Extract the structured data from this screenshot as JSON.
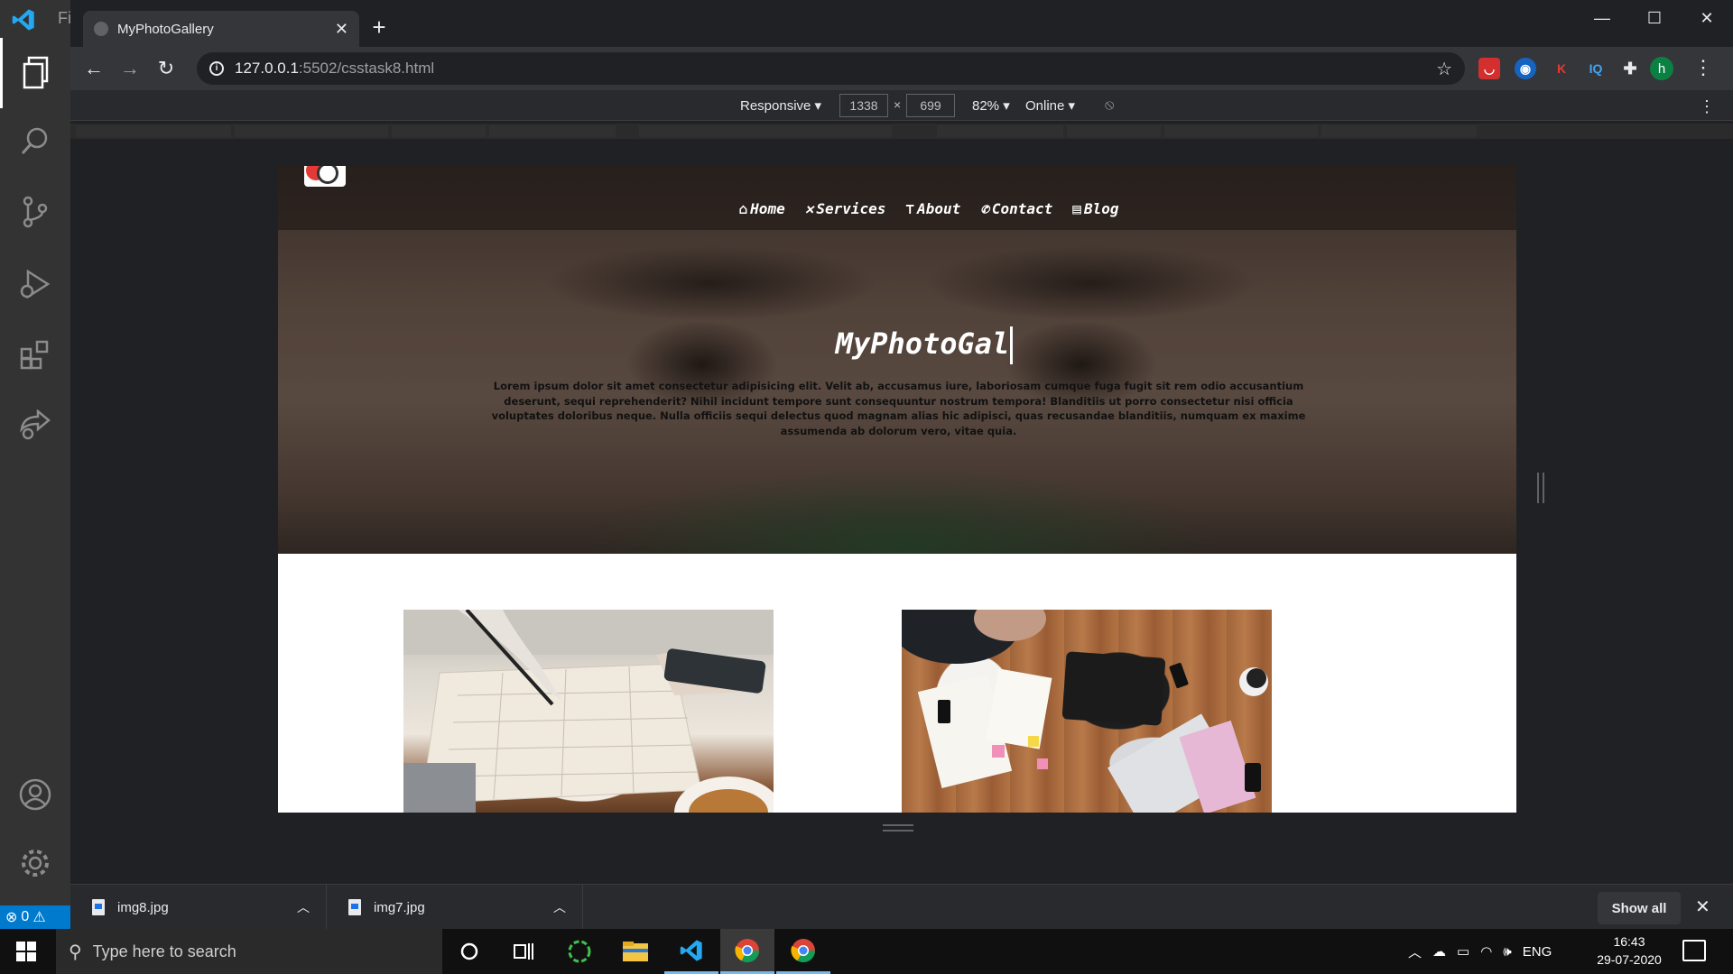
{
  "vscode": {
    "menu_fragment": "Fi",
    "activity_items": [
      "explorer-icon",
      "search-icon",
      "source-control-icon",
      "run-debug-icon",
      "extensions-icon",
      "live-share-icon",
      "account-icon",
      "settings-gear-icon"
    ],
    "status_errors": "0"
  },
  "browser": {
    "tab_title": "MyPhotoGallery",
    "url_host": "127.0.0.1",
    "url_rest": ":5502/csstask8.html",
    "profile_initial": "h",
    "ext_k": "K",
    "ext_iq": "IQ"
  },
  "devtools": {
    "device": "Responsive",
    "width": "1338",
    "height": "699",
    "times": "×",
    "zoom": "82%",
    "network": "Online"
  },
  "site": {
    "nav": [
      {
        "icon": "home-icon",
        "label": "Home"
      },
      {
        "icon": "tools-icon",
        "label": "Services"
      },
      {
        "icon": "pin-icon",
        "label": "About"
      },
      {
        "icon": "phone-icon",
        "label": "Contact"
      },
      {
        "icon": "document-icon",
        "label": "Blog"
      }
    ],
    "title": "MyPhotoGal",
    "intro": "Lorem ipsum dolor sit amet consectetur adipisicing elit. Velit ab, accusamus iure, laboriosam cumque fuga fugit sit rem odio accusantium deserunt, sequi reprehenderit? Nihil incidunt tempore sunt consequuntur nostrum tempora! Blanditiis ut porro consectetur nisi officia voluptates doloribus neque. Nulla officiis sequi delectus quod magnam alias hic adipisci, quas recusandae blanditiis, numquam ex maxime assumenda ab dolorum vero, vitae quia."
  },
  "downloads": {
    "items": [
      {
        "name": "img8.jpg"
      },
      {
        "name": "img7.jpg"
      }
    ],
    "show_all": "Show all"
  },
  "taskbar": {
    "search_placeholder": "Type here to search",
    "lang": "ENG",
    "time": "16:43",
    "date": "29-07-2020"
  }
}
